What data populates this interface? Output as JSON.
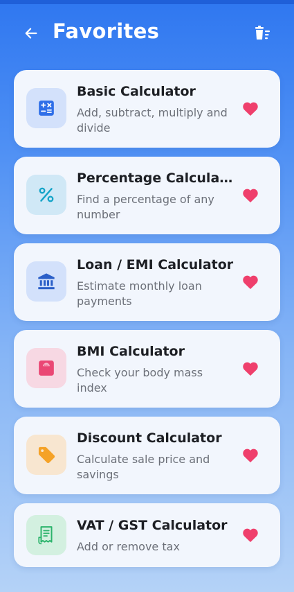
{
  "header": {
    "title": "Favorites",
    "back_icon": "arrow-left-icon",
    "clear_icon": "delete-sweep-icon"
  },
  "colors": {
    "heart": "#ef3f6c",
    "title": "#ffffff"
  },
  "favorites": [
    {
      "title": "Basic Calculator",
      "description": "Add, subtract, multiply and divide",
      "icon": "calculator-icon",
      "tile_color": "#d3e1fb",
      "icon_color": "#2f6fe8"
    },
    {
      "title": "Percentage Calcula…",
      "description": "Find a percentage of any number",
      "icon": "percent-icon",
      "tile_color": "#d0e8f6",
      "icon_color": "#14a4c8"
    },
    {
      "title": "Loan / EMI Calculator",
      "description": "Estimate monthly loan payments",
      "icon": "bank-icon",
      "tile_color": "#d3e1fb",
      "icon_color": "#2b5fc8"
    },
    {
      "title": "BMI Calculator",
      "description": "Check your body mass index",
      "icon": "scale-icon",
      "tile_color": "#f7d8e3",
      "icon_color": "#ea4774"
    },
    {
      "title": "Discount Calculator",
      "description": "Calculate sale price and savings",
      "icon": "tag-icon",
      "tile_color": "#f8e6d0",
      "icon_color": "#f5a227"
    },
    {
      "title": "VAT / GST Calculator",
      "description": "Add or remove tax",
      "icon": "receipt-icon",
      "tile_color": "#d3f0e0",
      "icon_color": "#2bb36b"
    }
  ]
}
